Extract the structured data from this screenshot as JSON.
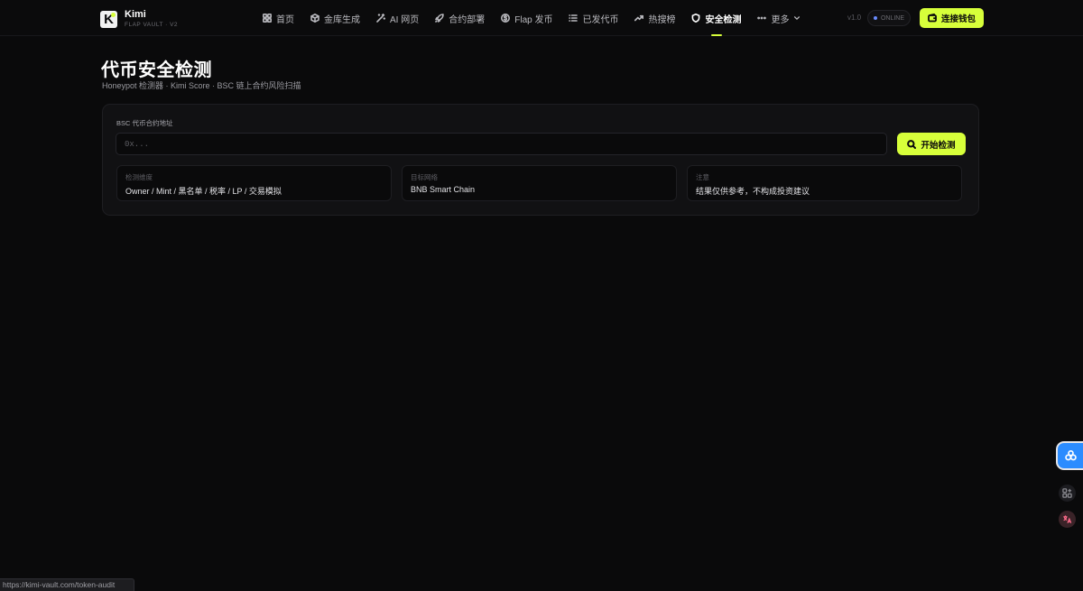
{
  "header": {
    "brand_name": "Kimi",
    "brand_sub": "FLAP VAULT · V2",
    "logo_letter": "K",
    "nav": [
      {
        "label": "首页",
        "icon": "grid-icon"
      },
      {
        "label": "金库生成",
        "icon": "cube-icon"
      },
      {
        "label": "AI 网页",
        "icon": "wand-icon"
      },
      {
        "label": "合约部署",
        "icon": "rocket-icon"
      },
      {
        "label": "Flap 发币",
        "icon": "coin-icon"
      },
      {
        "label": "已发代币",
        "icon": "list-icon"
      },
      {
        "label": "热搜榜",
        "icon": "trend-icon"
      },
      {
        "label": "安全检测",
        "icon": "shield-icon",
        "active": true
      },
      {
        "label": "更多",
        "icon": "more-icon"
      }
    ],
    "version": "v1.0",
    "status": "ONLINE",
    "connect_label": "连接钱包"
  },
  "page": {
    "title": "代币安全检测",
    "subtitle": "Honeypot 检测器 · Kimi Score · BSC 链上合约风险扫描"
  },
  "form": {
    "address_label": "BSC 代币合约地址",
    "address_placeholder": "0x...",
    "address_value": "",
    "scan_label": "开始检测"
  },
  "info": [
    {
      "label": "检测维度",
      "value": "Owner / Mint / 黑名单 / 税率 / LP / 交易模拟"
    },
    {
      "label": "目标网络",
      "value": "BNB Smart Chain"
    },
    {
      "label": "注意",
      "value": "结果仅供参考，不构成投资建议"
    }
  ],
  "status_url": "https://kimi-vault.com/token-audit",
  "colors": {
    "accent": "#d7ff3a",
    "background": "#0a0a0b",
    "card": "#111113",
    "fab": "#2b8cff"
  }
}
